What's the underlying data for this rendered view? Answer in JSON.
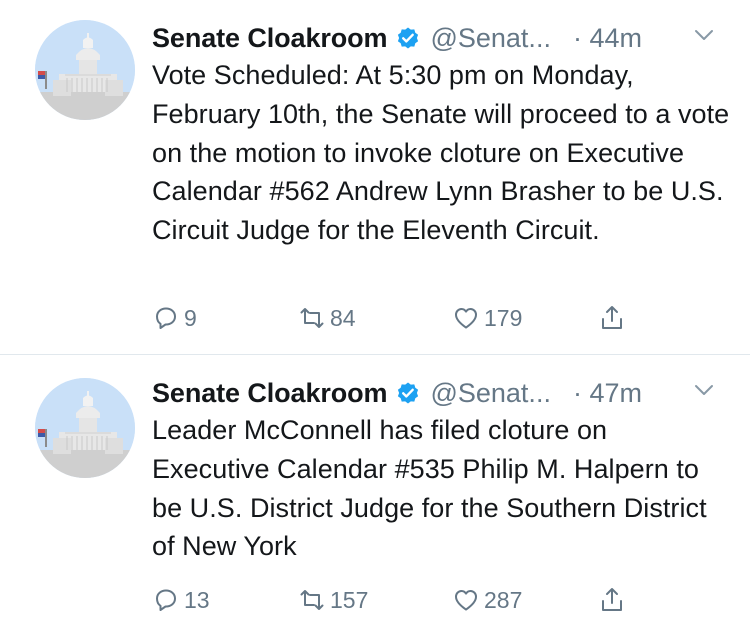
{
  "tweets": [
    {
      "display_name": "Senate Cloakroom",
      "handle": "@Senat...",
      "time": "· 44m",
      "text": "Vote Scheduled: At 5:30 pm on Monday, February 10th, the Senate will proceed to a vote on the motion to invoke cloture on Executive Calendar #562 Andrew Lynn Brasher to be U.S. Circuit Judge for the Eleventh Circuit.",
      "replies": "9",
      "retweets": "84",
      "likes": "179"
    },
    {
      "display_name": "Senate Cloakroom",
      "handle": "@Senat...",
      "time": "· 47m",
      "text": "Leader McConnell has filed cloture on Executive Calendar #535 Philip M. Halpern to be U.S. District Judge for the Southern District of New York",
      "replies": "13",
      "retweets": "157",
      "likes": "287"
    }
  ],
  "colors": {
    "accent": "#1da1f2",
    "text": "#14171a",
    "muted": "#657786",
    "divider": "#e1e8ed"
  },
  "icons": {
    "verified": "verified-badge-icon",
    "menu": "chevron-down-icon",
    "reply": "reply-icon",
    "retweet": "retweet-icon",
    "like": "heart-icon",
    "share": "share-icon"
  }
}
